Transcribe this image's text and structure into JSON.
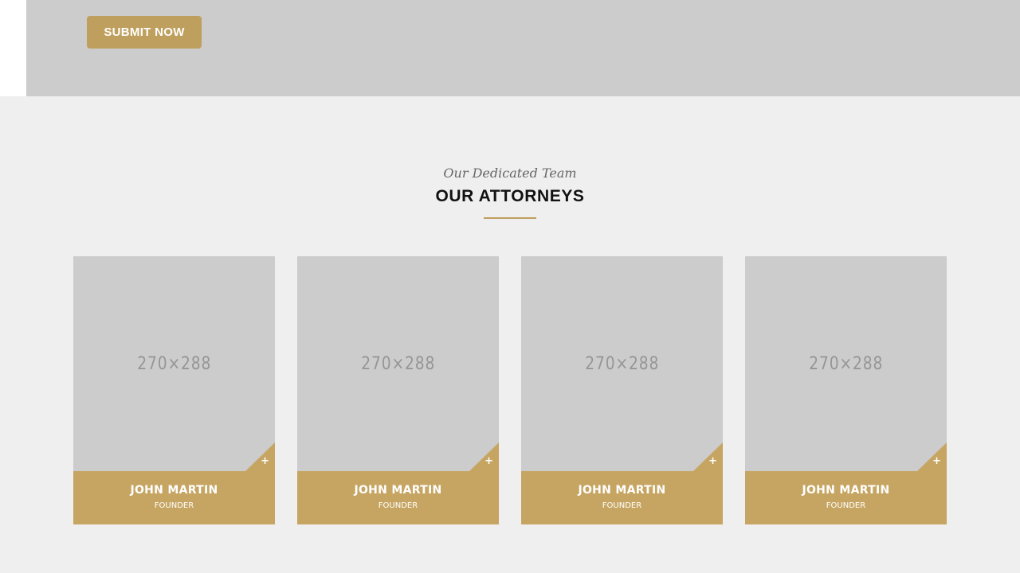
{
  "form": {
    "submit_label": "SUBMIT NOW"
  },
  "team_section": {
    "subtitle": "Our Dedicated Team",
    "title": "OUR ATTORNEYS",
    "accent_color": "#bf9f5d",
    "members": [
      {
        "photo_placeholder": "270×288",
        "name": "JOHN MARTIN",
        "role": "FOUNDER",
        "expand_icon": "plus-icon"
      },
      {
        "photo_placeholder": "270×288",
        "name": "JOHN MARTIN",
        "role": "FOUNDER",
        "expand_icon": "plus-icon"
      },
      {
        "photo_placeholder": "270×288",
        "name": "JOHN MARTIN",
        "role": "FOUNDER",
        "expand_icon": "plus-icon"
      },
      {
        "photo_placeholder": "270×288",
        "name": "JOHN MARTIN",
        "role": "FOUNDER",
        "expand_icon": "plus-icon"
      }
    ]
  }
}
